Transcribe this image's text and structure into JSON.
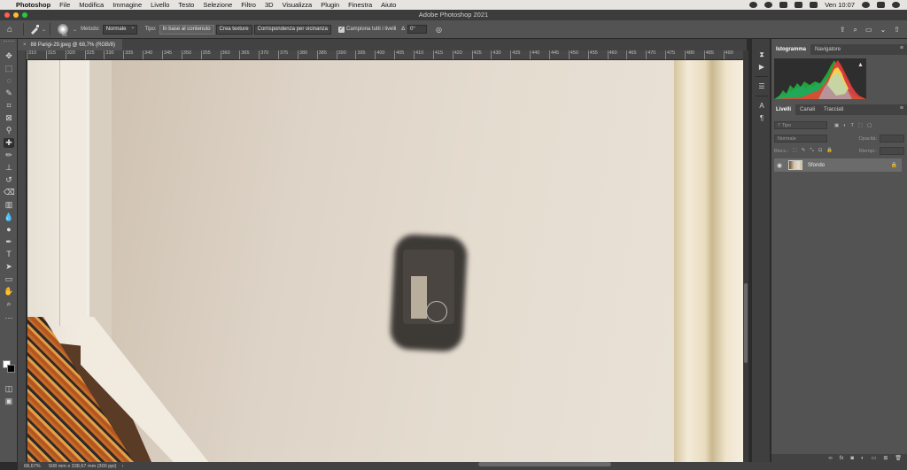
{
  "menubar": {
    "apple": "",
    "items": [
      "Photoshop",
      "File",
      "Modifica",
      "Immagine",
      "Livello",
      "Testo",
      "Selezione",
      "Filtro",
      "3D",
      "Visualizza",
      "Plugin",
      "Finestra",
      "Aiuto"
    ],
    "clock": "Ven 10:07"
  },
  "window": {
    "title": "Adobe Photoshop 2021",
    "lights": [
      "#ff5f57",
      "#febc2e",
      "#28c840"
    ]
  },
  "options": {
    "brush_size": "81",
    "metodo_label": "Metodo:",
    "metodo_value": "Normale",
    "tipo_label": "Tipo:",
    "tipo_options": [
      "In base al contenuto",
      "Crea texture",
      "Corrispondenza per vicinanza"
    ],
    "tipo_active": "In base al contenuto",
    "sample_all_label": "Campiona tutti i livelli",
    "sample_all_checked": "✓",
    "angle_icon": "∆",
    "angle_value": "0°"
  },
  "document": {
    "tab_title": "88 Parigi-29.jpeg @ 68,7% (RGB/8)",
    "close": "×"
  },
  "ruler": {
    "labels": [
      "310",
      "315",
      "320",
      "325",
      "330",
      "335",
      "340",
      "345",
      "350",
      "355",
      "360",
      "365",
      "370",
      "375",
      "380",
      "385",
      "390",
      "395",
      "400",
      "405",
      "410",
      "415",
      "420",
      "425",
      "430",
      "435",
      "440",
      "445",
      "450",
      "455",
      "460",
      "465",
      "470",
      "475",
      "480",
      "485",
      "490"
    ]
  },
  "status": {
    "zoom": "68,67%",
    "doc_size": "508 mm x 338,67 mm (300 ppi)",
    "arrow": "›"
  },
  "panels": {
    "top_tabs": [
      "Istogramma",
      "Navigatore"
    ],
    "layer_tabs": [
      "Livelli",
      "Canali",
      "Tracciati"
    ],
    "search_placeholder": "Tipo",
    "blend_mode": "Normale",
    "opacity_label": "Opacità:",
    "lock_label": "Blocc.:",
    "fill_label": "Riempi.:",
    "layer_name": "Sfondo",
    "warning_icon": "▲"
  },
  "colors": {
    "panel_bg": "#535353",
    "accent": "#2f2f2f",
    "canvas_wall": "#e5dcd0"
  }
}
